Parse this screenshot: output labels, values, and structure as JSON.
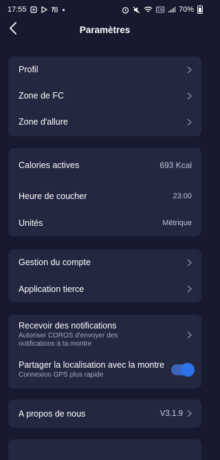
{
  "status": {
    "time": "17:55",
    "battery": "70%"
  },
  "header": {
    "title": "Paramètres"
  },
  "card1": {
    "items": [
      {
        "label": "Profil"
      },
      {
        "label": "Zone de FC"
      },
      {
        "label": "Zone d'allure"
      }
    ]
  },
  "card2": {
    "items": [
      {
        "label": "Calories actives",
        "value": "693 Kcal"
      },
      {
        "label": "Heure de coucher",
        "value": "23:00"
      },
      {
        "label": "Unités",
        "value": "Métrique"
      }
    ]
  },
  "card3": {
    "items": [
      {
        "label": "Gestion du compte"
      },
      {
        "label": "Application tierce"
      }
    ]
  },
  "card4": {
    "notifications": {
      "title": "Recevoir des notifications",
      "subtitle": "Autoriser COROS d'envoyer des notifications à ta montre"
    },
    "location": {
      "title": "Partager la localisation avec la montre",
      "subtitle": "Connexion GPS plus rapide",
      "enabled": true
    }
  },
  "card5": {
    "about": {
      "label": "A propos de nous",
      "value": "V3.1.9"
    }
  },
  "colors": {
    "background": "#171a2e",
    "card": "#232740",
    "accent": "#2a73e8"
  }
}
